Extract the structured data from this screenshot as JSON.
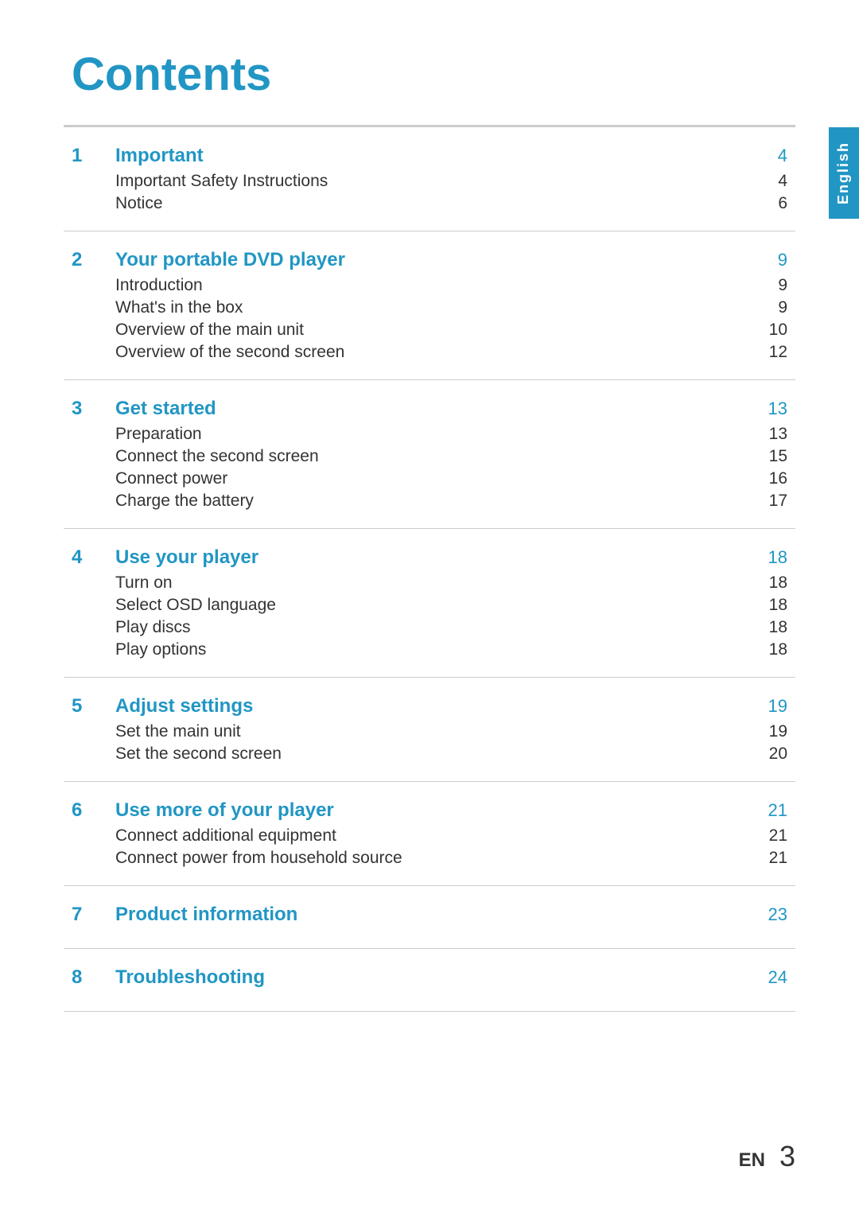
{
  "page": {
    "title": "Contents",
    "side_tab": "English",
    "footer": {
      "lang": "EN",
      "page_number": "3"
    }
  },
  "sections": [
    {
      "number": "1",
      "title": "Important",
      "page": "4",
      "sub_items": [
        {
          "label": "Important Safety Instructions",
          "page": "4"
        },
        {
          "label": "Notice",
          "page": "6"
        }
      ]
    },
    {
      "number": "2",
      "title": "Your portable DVD player",
      "page": "9",
      "sub_items": [
        {
          "label": "Introduction",
          "page": "9"
        },
        {
          "label": "What's in the box",
          "page": "9"
        },
        {
          "label": "Overview of the main unit",
          "page": "10"
        },
        {
          "label": "Overview of the second screen",
          "page": "12"
        }
      ]
    },
    {
      "number": "3",
      "title": "Get started",
      "page": "13",
      "sub_items": [
        {
          "label": "Preparation",
          "page": "13"
        },
        {
          "label": "Connect the second screen",
          "page": "15"
        },
        {
          "label": "Connect power",
          "page": "16"
        },
        {
          "label": "Charge the battery",
          "page": "17"
        }
      ]
    },
    {
      "number": "4",
      "title": "Use your player",
      "page": "18",
      "sub_items": [
        {
          "label": "Turn on",
          "page": "18"
        },
        {
          "label": "Select OSD language",
          "page": "18"
        },
        {
          "label": "Play discs",
          "page": "18"
        },
        {
          "label": "Play options",
          "page": "18"
        }
      ]
    },
    {
      "number": "5",
      "title": "Adjust settings",
      "page": "19",
      "sub_items": [
        {
          "label": "Set the main unit",
          "page": "19"
        },
        {
          "label": "Set the second screen",
          "page": "20"
        }
      ]
    },
    {
      "number": "6",
      "title": "Use more of your player",
      "page": "21",
      "sub_items": [
        {
          "label": "Connect additional equipment",
          "page": "21"
        },
        {
          "label": "Connect power from household source",
          "page": "21"
        }
      ]
    },
    {
      "number": "7",
      "title": "Product information",
      "page": "23",
      "sub_items": []
    },
    {
      "number": "8",
      "title": "Troubleshooting",
      "page": "24",
      "sub_items": []
    }
  ]
}
